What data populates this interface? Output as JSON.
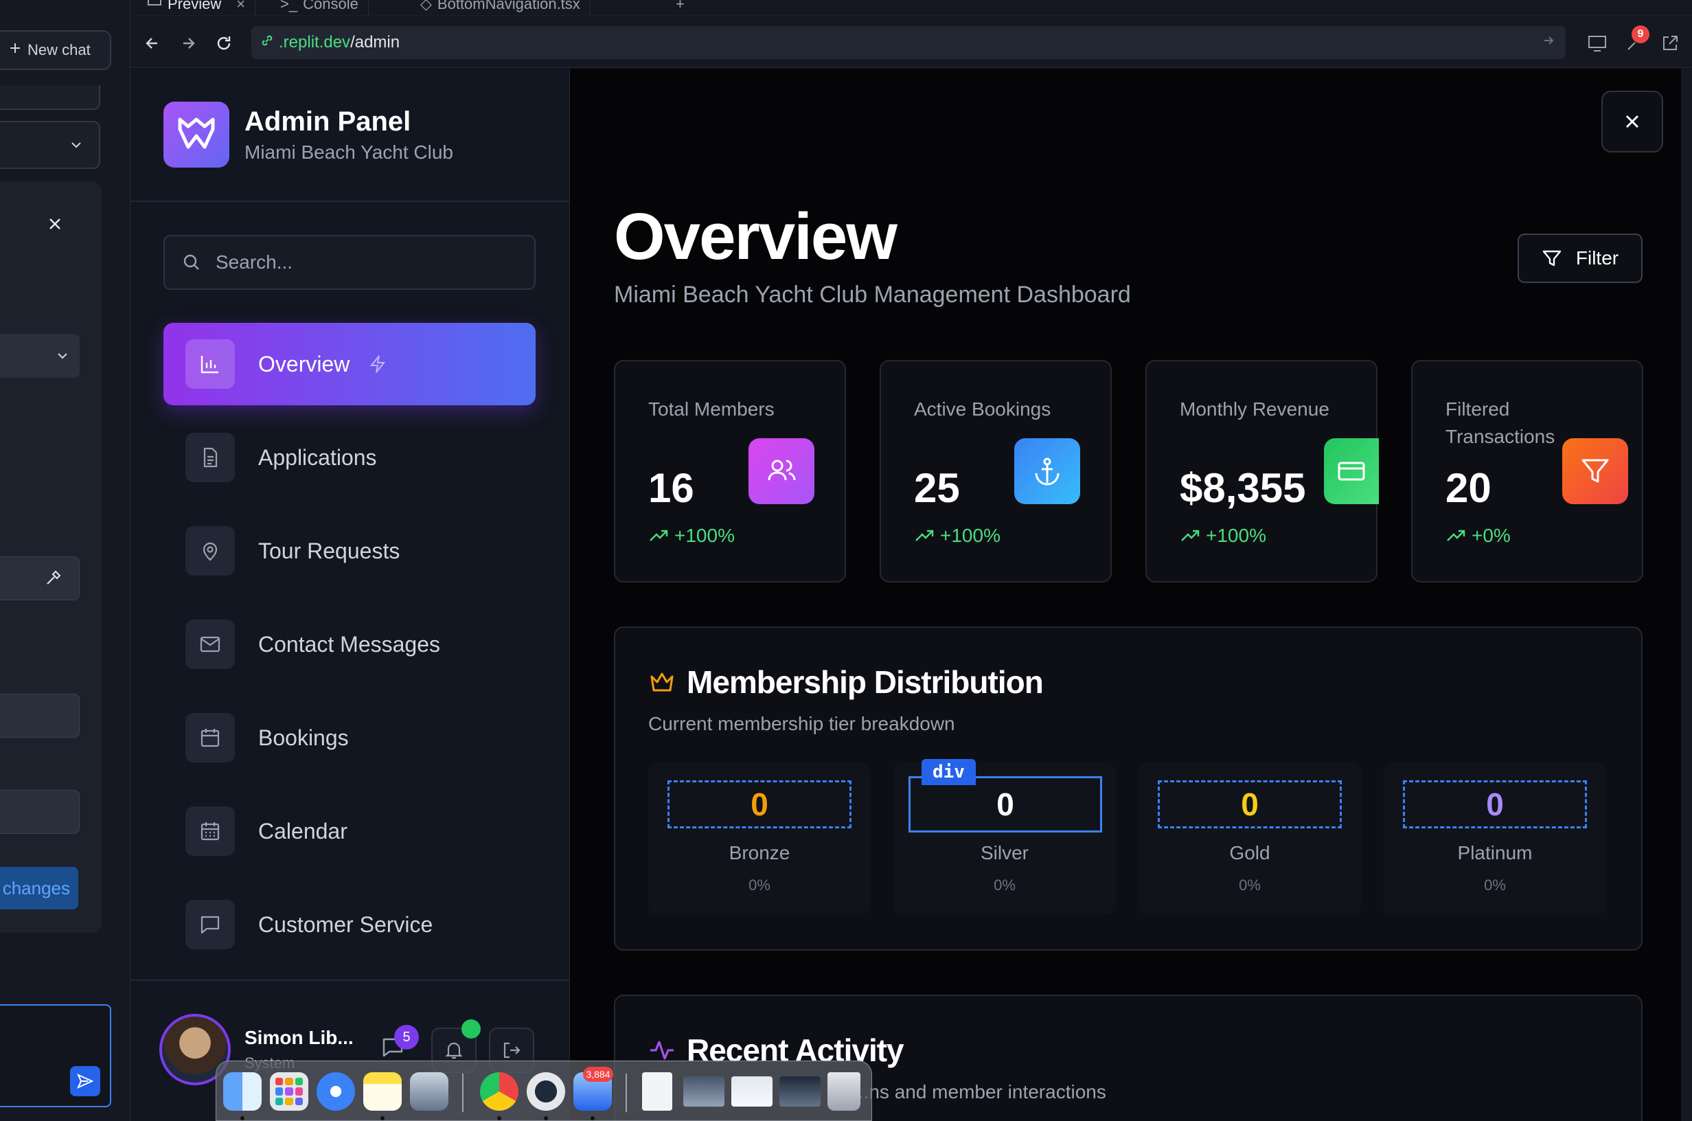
{
  "browser": {
    "tabs": [
      "Preview",
      "Console",
      "BottomNavigation.tsx"
    ],
    "url_host": ".replit.dev",
    "url_path": "/admin",
    "notification_count": "9"
  },
  "workspace": {
    "new_chat_label": "New chat",
    "changes_label": "changes"
  },
  "sidebar": {
    "title": "Admin Panel",
    "subtitle": "Miami Beach Yacht Club",
    "search_placeholder": "Search...",
    "items": [
      {
        "label": "Overview",
        "icon": "bar-chart-icon",
        "active": true
      },
      {
        "label": "Applications",
        "icon": "file-text-icon"
      },
      {
        "label": "Tour Requests",
        "icon": "map-pin-icon"
      },
      {
        "label": "Contact Messages",
        "icon": "mail-icon"
      },
      {
        "label": "Bookings",
        "icon": "calendar-icon"
      },
      {
        "label": "Calendar",
        "icon": "calendar-days-icon"
      },
      {
        "label": "Customer Service",
        "icon": "message-square-icon"
      }
    ],
    "user": {
      "name": "Simon Lib...",
      "role": "System",
      "message_count": "5"
    }
  },
  "main": {
    "title": "Overview",
    "subtitle": "Miami Beach Yacht Club Management Dashboard",
    "filter_label": "Filter",
    "stats": [
      {
        "label": "Total Members",
        "value": "16",
        "trend": "+100%",
        "icon": "users-icon",
        "color": "#c026d3"
      },
      {
        "label": "Active Bookings",
        "value": "25",
        "trend": "+100%",
        "icon": "anchor-icon",
        "color": "#3b82f6"
      },
      {
        "label": "Monthly Revenue",
        "value": "$8,355",
        "trend": "+100%",
        "icon": "credit-card-icon",
        "color": "#22c55e"
      },
      {
        "label": "Filtered Transactions",
        "value": "20",
        "trend": "+0%",
        "icon": "filter-icon",
        "color": "#f97316"
      }
    ],
    "membership": {
      "title": "Membership Distribution",
      "subtitle": "Current membership tier breakdown",
      "inspector_tag": "div",
      "tiers": [
        {
          "name": "Bronze",
          "count": "0",
          "percent": "0%",
          "color": "#f59e0b"
        },
        {
          "name": "Silver",
          "count": "0",
          "percent": "0%",
          "color": "#ffffff"
        },
        {
          "name": "Gold",
          "count": "0",
          "percent": "0%",
          "color": "#facc15"
        },
        {
          "name": "Platinum",
          "count": "0",
          "percent": "0%",
          "color": "#a78bfa"
        }
      ]
    },
    "activity": {
      "title": "Recent Activity",
      "subtitle": "...ns and member interactions"
    }
  },
  "dock": {
    "mail_badge": "3,884"
  }
}
